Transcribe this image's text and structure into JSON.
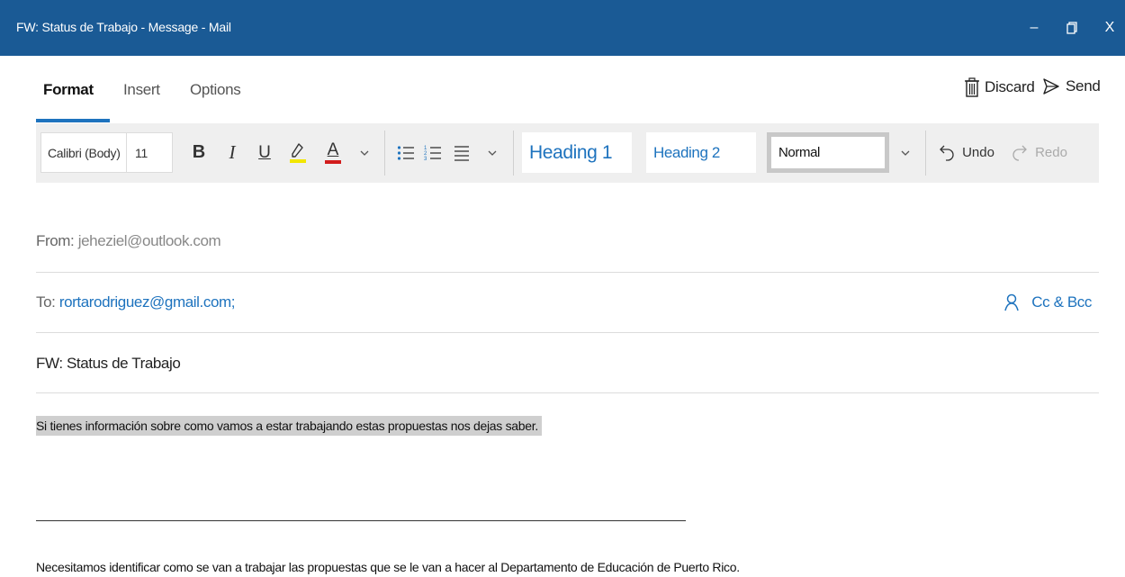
{
  "window": {
    "title": "FW: Status de Trabajo - Message - Mail",
    "minimize_glyph": "–",
    "restore_glyph": "▯",
    "close_glyph": "X"
  },
  "tabs": [
    {
      "label": "Format",
      "active": true
    },
    {
      "label": "Insert",
      "active": false
    },
    {
      "label": "Options",
      "active": false
    }
  ],
  "actions": {
    "discard_label": "Discard",
    "send_label": "Send"
  },
  "toolbar": {
    "font_name": "Calibri (Body)",
    "font_size": "11",
    "bold": "B",
    "italic": "I",
    "underline": "U",
    "font_color_letter": "A",
    "styles": [
      "Heading 1",
      "Heading 2",
      "Normal"
    ],
    "undo_label": "Undo",
    "redo_label": "Redo"
  },
  "message": {
    "from_label": "From:",
    "from_value": "jeheziel@outlook.com",
    "to_label": "To:",
    "to_value": "rortarodriguez@gmail.com;",
    "cc_bcc_label": "Cc & Bcc",
    "subject": "FW: Status de Trabajo"
  },
  "body": {
    "line1": "Si tienes información  sobre como vamos a estar trabajando estas propuestas nos dejas saber.",
    "line2": "Necesitamos identificar como se van a trabajar las propuestas que se le van a hacer al Departamento de Educación de Puerto Rico."
  },
  "colors": {
    "titlebar": "#1a5a95",
    "accent": "#1e73be",
    "highlight_yellow": "#f2e600",
    "font_red": "#d21c1c"
  }
}
